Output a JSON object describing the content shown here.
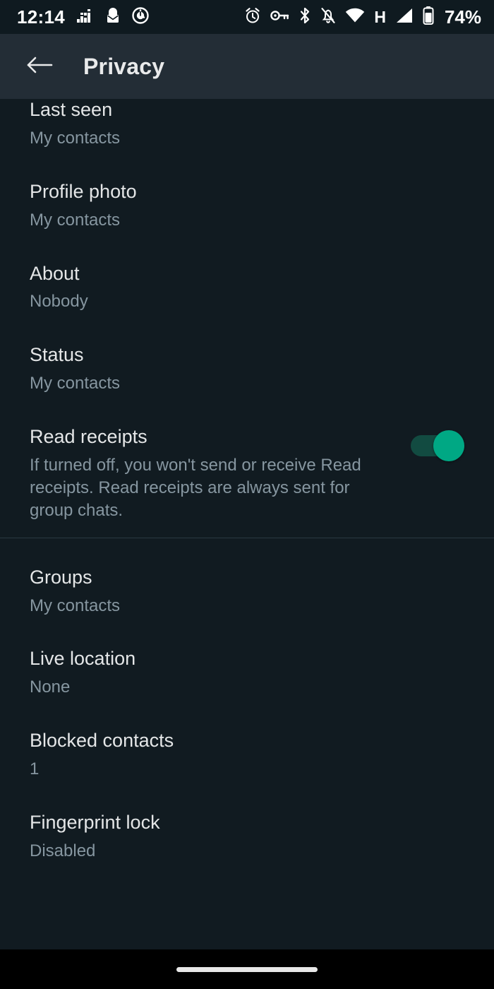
{
  "status_bar": {
    "clock": "12:14",
    "battery_percent": "74%",
    "network_type": "H",
    "left_icons": [
      "equalizer-icon",
      "mail-icon",
      "sync-icon"
    ],
    "right_icons": [
      "alarm-icon",
      "vpn-key-icon",
      "bluetooth-icon",
      "notifications-muted-icon",
      "wifi-icon",
      "cellular-signal-icon",
      "battery-icon"
    ],
    "background": "#0f1a20",
    "foreground": "#ffffff"
  },
  "app_bar": {
    "back_icon": "arrow-back-icon",
    "title": "Privacy",
    "background": "#232d36"
  },
  "colors": {
    "page_background": "#111b21",
    "primary_text": "#e4e6e7",
    "secondary_text": "#8696a0",
    "divider": "#2a3942",
    "accent_on": "#00a884",
    "accent_track": "#124b41",
    "nav_background": "#000000"
  },
  "sections": [
    {
      "name": "visibility",
      "rows": [
        {
          "name": "last-seen",
          "title": "Last seen",
          "subtitle": "My contacts",
          "control": "none"
        },
        {
          "name": "profile-photo",
          "title": "Profile photo",
          "subtitle": "My contacts",
          "control": "none"
        },
        {
          "name": "about",
          "title": "About",
          "subtitle": "Nobody",
          "control": "none"
        },
        {
          "name": "status",
          "title": "Status",
          "subtitle": "My contacts",
          "control": "none"
        },
        {
          "name": "read-receipts",
          "title": "Read receipts",
          "subtitle": "If turned off, you won't send or receive Read receipts. Read receipts are always sent for group chats.",
          "control": "toggle",
          "toggle_state": "on"
        }
      ]
    },
    {
      "name": "more-privacy",
      "rows": [
        {
          "name": "groups",
          "title": "Groups",
          "subtitle": "My contacts",
          "control": "none"
        },
        {
          "name": "live-location",
          "title": "Live location",
          "subtitle": "None",
          "control": "none"
        },
        {
          "name": "blocked-contacts",
          "title": "Blocked contacts",
          "subtitle": "1",
          "control": "none"
        },
        {
          "name": "fingerprint-lock",
          "title": "Fingerprint lock",
          "subtitle": "Disabled",
          "control": "none"
        }
      ]
    }
  ],
  "nav_bar": {
    "handle": "gesture-handle"
  }
}
